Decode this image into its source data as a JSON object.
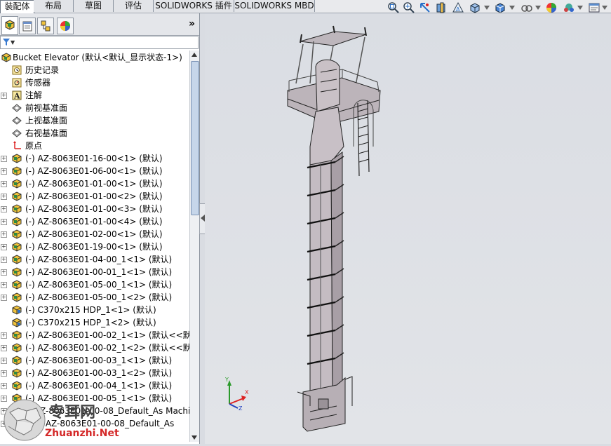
{
  "tabs": [
    {
      "label": "装配体",
      "active": true
    },
    {
      "label": "布局"
    },
    {
      "label": "草图"
    },
    {
      "label": "评估"
    },
    {
      "label": "SOLIDWORKS 插件"
    },
    {
      "label": "SOLIDWORKS MBD"
    }
  ],
  "heads_up_toolbar": [
    "zoom-to-fit-icon",
    "zoom-area-icon",
    "previous-view-icon",
    "section-view-icon",
    "dynamic-annotation-icon",
    "view-orientation-icon",
    "display-style-icon",
    "hide-show-icon",
    "edit-appearance-icon",
    "apply-scene-icon",
    "view-settings-icon"
  ],
  "panel": {
    "tabs": [
      "featuremanager-icon",
      "propertymanager-icon",
      "configurationmanager-icon",
      "displaymanager-icon"
    ],
    "expand_glyph": "»",
    "filter_glyph": "▼"
  },
  "tree": {
    "root": "Bucket Elevator  (默认<默认_显示状态-1>)",
    "items": [
      {
        "label": "历史记录",
        "icon": "history-icon",
        "expand": false
      },
      {
        "label": "传感器",
        "icon": "sensor-icon",
        "expand": false
      },
      {
        "label": "注解",
        "icon": "annotation-icon",
        "expand": true
      },
      {
        "label": "前视基准面",
        "icon": "plane-icon",
        "expand": false
      },
      {
        "label": "上视基准面",
        "icon": "plane-icon",
        "expand": false
      },
      {
        "label": "右视基准面",
        "icon": "plane-icon",
        "expand": false
      },
      {
        "label": "原点",
        "icon": "origin-icon",
        "expand": false
      },
      {
        "label": "(-) AZ-8063E01-16-00<1> (默认)",
        "icon": "subassembly-icon",
        "expand": true
      },
      {
        "label": "(-) AZ-8063E01-06-00<1> (默认)",
        "icon": "subassembly-icon",
        "expand": true
      },
      {
        "label": "(-) AZ-8063E01-01-00<1> (默认)",
        "icon": "subassembly-icon",
        "expand": true
      },
      {
        "label": "(-) AZ-8063E01-01-00<2> (默认)",
        "icon": "subassembly-icon",
        "expand": true
      },
      {
        "label": "(-) AZ-8063E01-01-00<3> (默认)",
        "icon": "subassembly-icon",
        "expand": true
      },
      {
        "label": "(-) AZ-8063E01-01-00<4> (默认)",
        "icon": "subassembly-icon",
        "expand": true
      },
      {
        "label": "(-) AZ-8063E01-02-00<1> (默认)",
        "icon": "subassembly-icon",
        "expand": true
      },
      {
        "label": "(-) AZ-8063E01-19-00<1> (默认)",
        "icon": "subassembly-icon",
        "expand": true
      },
      {
        "label": "(-) AZ-8063E01-04-00_1<1> (默认)",
        "icon": "subassembly-icon",
        "expand": true
      },
      {
        "label": "(-) AZ-8063E01-00-01_1<1> (默认)",
        "icon": "subassembly-icon",
        "expand": true
      },
      {
        "label": "(-) AZ-8063E01-05-00_1<1> (默认)",
        "icon": "subassembly-icon",
        "expand": true
      },
      {
        "label": "(-) AZ-8063E01-05-00_1<2> (默认)",
        "icon": "subassembly-icon",
        "expand": true
      },
      {
        "label": "(-) C370x215 HDP_1<1> (默认)",
        "icon": "part-icon",
        "expand": false
      },
      {
        "label": "(-) C370x215 HDP_1<2> (默认)",
        "icon": "part-icon",
        "expand": false
      },
      {
        "label": "(-) AZ-8063E01-00-02_1<1> (默认<<默认",
        "icon": "subassembly-icon",
        "expand": true
      },
      {
        "label": "(-) AZ-8063E01-00-02_1<2> (默认<<默认",
        "icon": "subassembly-icon",
        "expand": true
      },
      {
        "label": "(-) AZ-8063E01-00-03_1<1> (默认)",
        "icon": "subassembly-icon",
        "expand": true
      },
      {
        "label": "(-) AZ-8063E01-00-03_1<2> (默认)",
        "icon": "subassembly-icon",
        "expand": true
      },
      {
        "label": "(-) AZ-8063E01-00-04_1<1> (默认)",
        "icon": "subassembly-icon",
        "expand": true
      },
      {
        "label": "(-) AZ-8063E01-00-05_1<1> (默认)",
        "icon": "subassembly-icon",
        "expand": true
      },
      {
        "label": "-) AZ-8063E01-00-08_Default_As Machin",
        "icon": "subassembly-icon",
        "expand": true
      },
      {
        "label": "irror AZ-8063E01-00-08_Default_As",
        "icon": "subassembly-icon",
        "expand": true
      }
    ]
  },
  "triad": {
    "x": "X",
    "y": "Y",
    "z": "Z"
  },
  "watermark": {
    "title": "专耳网",
    "url": "Zhuanzhi.Net"
  },
  "colors": {
    "tab_active": "#ffffff",
    "viewport": "#dcdfe4",
    "model": "#c3bbc0",
    "accent": "#d22222"
  }
}
